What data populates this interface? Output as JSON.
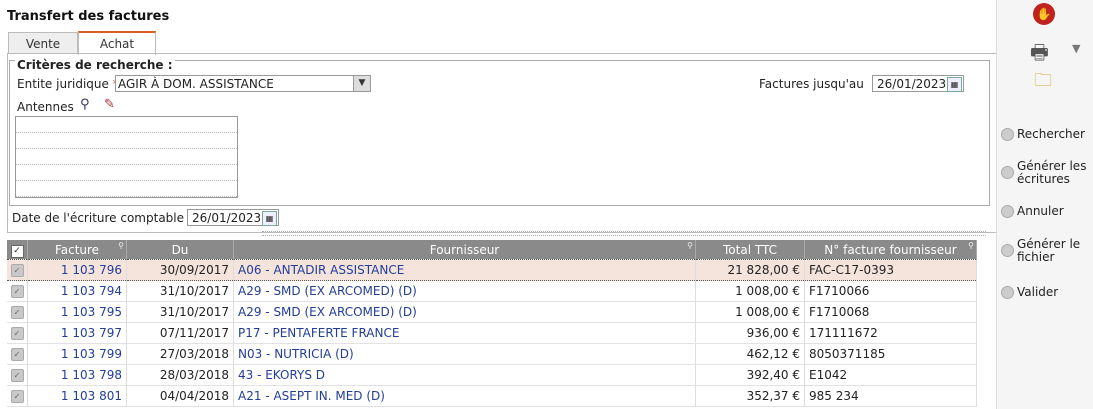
{
  "title": "Transfert des factures",
  "tabs": [
    {
      "label": "Vente"
    },
    {
      "label": "Achat"
    }
  ],
  "criteria": {
    "legend": "Critères de recherche :",
    "entite_label": "Entite juridique",
    "entite_value": "AGIR À DOM. ASSISTANCE",
    "factures_label": "Factures jusqu'au",
    "factures_date": "26/01/2023",
    "antennes_label": "Antennes"
  },
  "ecriture": {
    "label": "Date de l'écriture comptable",
    "date": "26/01/2023"
  },
  "required_mark": "*",
  "table": {
    "headers": [
      "Facture",
      "Du",
      "Fournisseur",
      "Total TTC",
      "N° facture fournisseur"
    ],
    "rows": [
      {
        "facture": "1 103 796",
        "du": "30/09/2017",
        "fournisseur": "A06 - ANTADIR ASSISTANCE",
        "ttc": "21 828,00 €",
        "num": "FAC-C17-0393"
      },
      {
        "facture": "1 103 794",
        "du": "31/10/2017",
        "fournisseur": "A29 - SMD (EX ARCOMED) (D)",
        "ttc": "1 008,00 €",
        "num": "F1710066"
      },
      {
        "facture": "1 103 795",
        "du": "31/10/2017",
        "fournisseur": "A29 - SMD (EX ARCOMED) (D)",
        "ttc": "1 008,00 €",
        "num": "F1710068"
      },
      {
        "facture": "1 103 797",
        "du": "07/11/2017",
        "fournisseur": "P17 - PENTAFERTE FRANCE",
        "ttc": "936,00 €",
        "num": "171111672"
      },
      {
        "facture": "1 103 799",
        "du": "27/03/2018",
        "fournisseur": "N03 - NUTRICIA  (D)",
        "ttc": "462,12 €",
        "num": "8050371185"
      },
      {
        "facture": "1 103 798",
        "du": "28/03/2018",
        "fournisseur": "43 - EKORYS D",
        "ttc": "392,40 €",
        "num": "E1042"
      },
      {
        "facture": "1 103 801",
        "du": "04/04/2018",
        "fournisseur": "A21 - ASEPT IN. MED (D)",
        "ttc": "352,37 €",
        "num": "985 234"
      }
    ]
  },
  "sidebar": {
    "rechercher": "Rechercher",
    "generer_ecritures": [
      "Générer les",
      "écritures"
    ],
    "annuler": "Annuler",
    "generer_fichier": [
      "Générer le",
      "fichier"
    ],
    "valider": "Valider"
  }
}
